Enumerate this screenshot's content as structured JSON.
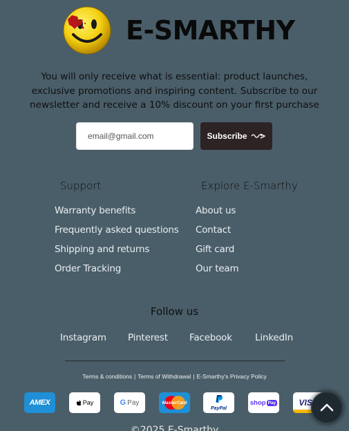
{
  "brand": {
    "name": "E-SMARTHY",
    "logo_icon": "smiley-face-icon"
  },
  "newsletter": {
    "intro": "You will only receive what is essential: product launches, exclusive promotions and inspiring content. Subscribe to our newsletter and receive a 10% discount on your first purchase",
    "email_value": "email@gmail.com",
    "subscribe_label": "Subscribe",
    "subscribe_icon": "wavy-arrow-icon"
  },
  "support": {
    "title": "Support",
    "links": [
      "Warranty benefits",
      "Frequently asked questions",
      "Shipping and returns",
      "Order Tracking"
    ]
  },
  "explore": {
    "title": "Explore E-Smarthy",
    "links": [
      "About us",
      "Contact",
      "Gift card",
      "Our team"
    ]
  },
  "follow": {
    "title": "Follow us",
    "links": [
      "Instagram",
      "Pinterest",
      "Facebook",
      "LinkedIn"
    ]
  },
  "legal": {
    "links": [
      "Terms & conditions",
      "Terms of Withdrawal",
      "E-Smarthy's Privacy Policy"
    ],
    "separator": "|"
  },
  "payments": {
    "amex": "AMEX",
    "apple_pay": "Pay",
    "google_pay": "Pay",
    "google_g": "G",
    "mastercard": "MasterCard",
    "paypal": "PayPal",
    "shop_pay": "shop",
    "shop_pay_badge": "Pay",
    "visa": "VISA"
  },
  "copyright": "©2025 E-Smarthy",
  "scroll_top_icon": "chevron-up-icon",
  "colors": {
    "background": "#4a5e69",
    "subscribe_button": "#2d2325",
    "scroll_top_button": "#1f2a30"
  }
}
